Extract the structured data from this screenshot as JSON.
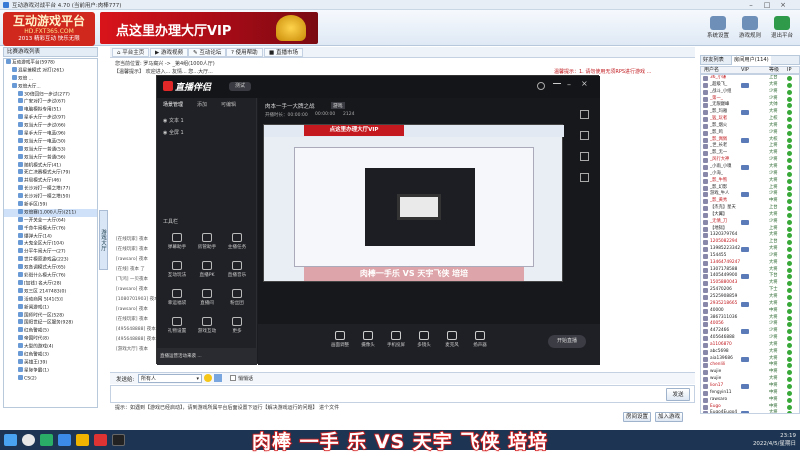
{
  "window": {
    "title": "互动游戏对战平台 4.70 (当前用户:肉棒777)"
  },
  "header": {
    "logo_main": "互动游戏平台",
    "logo_url": "HD.FXT365.COM",
    "logo_slogan": "2013 精彩互动 快乐无限",
    "vip_banner": "点这里办理大厅VIP",
    "buttons": [
      {
        "label": "系统设置",
        "icon": "gear-icon"
      },
      {
        "label": "游戏规则",
        "icon": "rules-icon"
      },
      {
        "label": "退出平台",
        "icon": "exit-icon"
      }
    ]
  },
  "left": {
    "title": "比赛游戏列表",
    "tree": [
      "互动游戏平台(5978)",
      "混星兼模式 对打(261)",
      "双倍 ...",
      "双倍大厅...",
      "30倍回归一步过(277)",
      "广安对打一步过(67)",
      "电脑模拟专用(51)",
      "星手大厅一步过(97)",
      "双当大厅一步过(66)",
      "星手大厅一电蓝(96)",
      "双当大厅一电蓝(50)",
      "双当大厅一普通(53)",
      "双当大厅一普通(56)",
      "随机模式大厅(41)",
      "死亡决赛模式大厅(79)",
      "并局模式大厅(46)",
      "长沙对打一模之塔(77)",
      "长沙对打一模之塔(50)",
      "新手区(59)",
      "双倍赛(1,000人厅)(211)",
      "一开关全一大厅(64)",
      "千命牛闹模大厅(76)",
      "爆弹大厅(14)",
      "大鬼全区大厅(104)",
      "分平牛闹大厅一(27)",
      "世片模原游戏品(223)",
      "双各调模式大厅(65)",
      "彩斑什么模大厅(76)",
      "[加钱] 名大厅(28)",
      "双三区 2147483(0)",
      "活动商网 5[41(5)]",
      "新闻游戏(1)",
      "国师时代一区(528)",
      "国阳世纪一区服务(928)",
      "红色警戒(5)",
      "帝国时代(8)",
      "大型的游戏(4)",
      "红色警戒(3)",
      "英雄王(39)",
      "星际争霸(1)",
      "CS(2)"
    ],
    "selected_index": 19,
    "side_tab": "游戏大厅"
  },
  "tabs": [
    {
      "label": "平台主页",
      "icon": "home-icon"
    },
    {
      "label": "游戏视频",
      "icon": "video-icon"
    },
    {
      "label": "互动论坛",
      "icon": "forum-icon"
    },
    {
      "label": "使用帮助",
      "icon": "help-icon"
    },
    {
      "label": "直播市场",
      "icon": "market-icon"
    }
  ],
  "breadcrumb": "您当前位置: 罗马裔兴 -> _第4组(1000人厅)",
  "announcement": "【温馨提示】 欢迎进入... 友情... 您...大厅...",
  "announcement_right": "温馨提示：1. 请勿使用无须RPS进行游戏 ...",
  "chat_lines": [
    "[在线玩家] 夜本",
    "[在线玩家] 夜本",
    "[rawsaro] 夜本",
    "[在线] 夜本 了",
    "[飞鸿] 一贝夜本",
    "[rawsaro] 夜本",
    "[1080701903] 夜本",
    "[rawsaro] 夜本",
    "[在线玩家] 夜本",
    "[495648888] 夜本",
    "[495648888] 夜本",
    "[游戏大厅] 夜本"
  ],
  "send": {
    "label": "发送给:",
    "target": "所有人",
    "checkbox_label": "悄悄话",
    "button": "发送"
  },
  "status": "提示：如遇到【游戏已经启动】，请到游戏所属平台后面设置下运行【解决游戏运行的问题】 进个文件",
  "room_buttons": [
    "房间设置",
    "加入游戏"
  ],
  "right": {
    "tabs": [
      "好友列表",
      "房间用户(114)"
    ],
    "columns": [
      "用户名",
      "VIP",
      "等级",
      "IP"
    ],
    "users": [
      {
        "name": "36_小谦",
        "lv": "上台"
      },
      {
        "name": "_超级飞_",
        "lv": "大将"
      },
      {
        "name": "_战斗_小组",
        "lv": "少将"
      },
      {
        "name": "_第一_",
        "lv": "少将"
      },
      {
        "name": "_无限巅峰",
        "lv": "大帅"
      },
      {
        "name": "_影_玛雅",
        "lv": "大将"
      },
      {
        "name": "_猛_玩者",
        "lv": "上校"
      },
      {
        "name": "_影_烟火",
        "lv": "大将"
      },
      {
        "name": "_影_鸣",
        "lv": "少将"
      },
      {
        "name": "_影_佩佩",
        "lv": "大校"
      },
      {
        "name": "_世_长老",
        "lv": "上将"
      },
      {
        "name": "_影_无一",
        "lv": "大将"
      },
      {
        "name": "_风行大神",
        "lv": "少将"
      },
      {
        "name": "_小雨_小嗅",
        "lv": "大将"
      },
      {
        "name": "_小海_",
        "lv": "少将"
      },
      {
        "name": "_影_牛熊",
        "lv": "大将"
      },
      {
        "name": "_影_幻影",
        "lv": "上将"
      },
      {
        "name": "游戏_牛人",
        "lv": "少将"
      },
      {
        "name": "_影_黄秀",
        "lv": "中将"
      },
      {
        "name": "【杰克】星天",
        "lv": "上台"
      },
      {
        "name": "【大翼】",
        "lv": "大将"
      },
      {
        "name": "_无情_刀",
        "lv": "少将"
      },
      {
        "name": "【地狱】",
        "lv": "上将"
      },
      {
        "name": "1320379764",
        "lv": "大将"
      },
      {
        "name": "1205082294",
        "lv": "上台"
      },
      {
        "name": "13985223342",
        "lv": "大将"
      },
      {
        "name": "154455",
        "lv": "少将"
      },
      {
        "name": "13464749247",
        "lv": "大将"
      },
      {
        "name": "1307178588",
        "lv": "大将"
      },
      {
        "name": "1405449900",
        "lv": "下台"
      },
      {
        "name": "1505880043",
        "lv": "大将"
      },
      {
        "name": "25470206",
        "lv": "下士"
      },
      {
        "name": "2525908859",
        "lv": "大将"
      },
      {
        "name": "2935218665",
        "lv": "大将"
      },
      {
        "name": "40000",
        "lv": "中将"
      },
      {
        "name": "3867311036",
        "lv": "大将"
      },
      {
        "name": "40056",
        "lv": "少将"
      },
      {
        "name": "4472466",
        "lv": "少将"
      },
      {
        "name": "405646888",
        "lv": "少将"
      },
      {
        "name": "a1106870",
        "lv": "大将"
      },
      {
        "name": "abc5698",
        "lv": "大将"
      },
      {
        "name": "aia139686",
        "lv": "大将"
      },
      {
        "name": "chenlili",
        "lv": "中将"
      },
      {
        "name": "wujie",
        "lv": "中将"
      },
      {
        "name": "wujie",
        "lv": "大将"
      },
      {
        "name": "lion17",
        "lv": "中将"
      },
      {
        "name": "fengyin11",
        "lv": "中将"
      },
      {
        "name": "rawsaro",
        "lv": "中将"
      },
      {
        "name": "Eugo",
        "lv": "中将"
      },
      {
        "name": "Eugo4Eugo4",
        "lv": "大将"
      }
    ]
  },
  "overlay": {
    "app_name": "直播伴侣",
    "badge": "测试",
    "tabs": [
      "场景管理",
      "添加",
      "可编辑"
    ],
    "scenes": [
      "文本 1",
      "全屏 1"
    ],
    "tools_label": "工具栏",
    "tools": [
      "弹幕助手",
      "房管助手",
      "主播任务",
      "互动玩法",
      "直播PK",
      "直播音乐",
      "幸运福袋",
      "直播间",
      "粉丝团",
      "礼物设置",
      "游戏互动",
      "更多"
    ],
    "stream_title": "肉本一手一大牌之战",
    "stream_tag": "游戏",
    "stream_stats": [
      "开播时长：00:00:00",
      "00:00:00",
      "2124"
    ],
    "preview_banner": "点这里办理大厅VIP",
    "preview_caption": "肉棒一手乐 VS 天宇飞侠 培培",
    "bottom_buttons": [
      "画面调整",
      "摄像头",
      "手机投屏",
      "多镜头",
      "麦克风",
      "扬声器"
    ],
    "go_live": "开始直播",
    "note": "直播运营活动来袭 ..."
  },
  "caption": "肉棒 一手 乐   VS   天宇 飞侠 培培",
  "clock": {
    "time": "23:19",
    "date": "2022/4/5/星期日"
  }
}
